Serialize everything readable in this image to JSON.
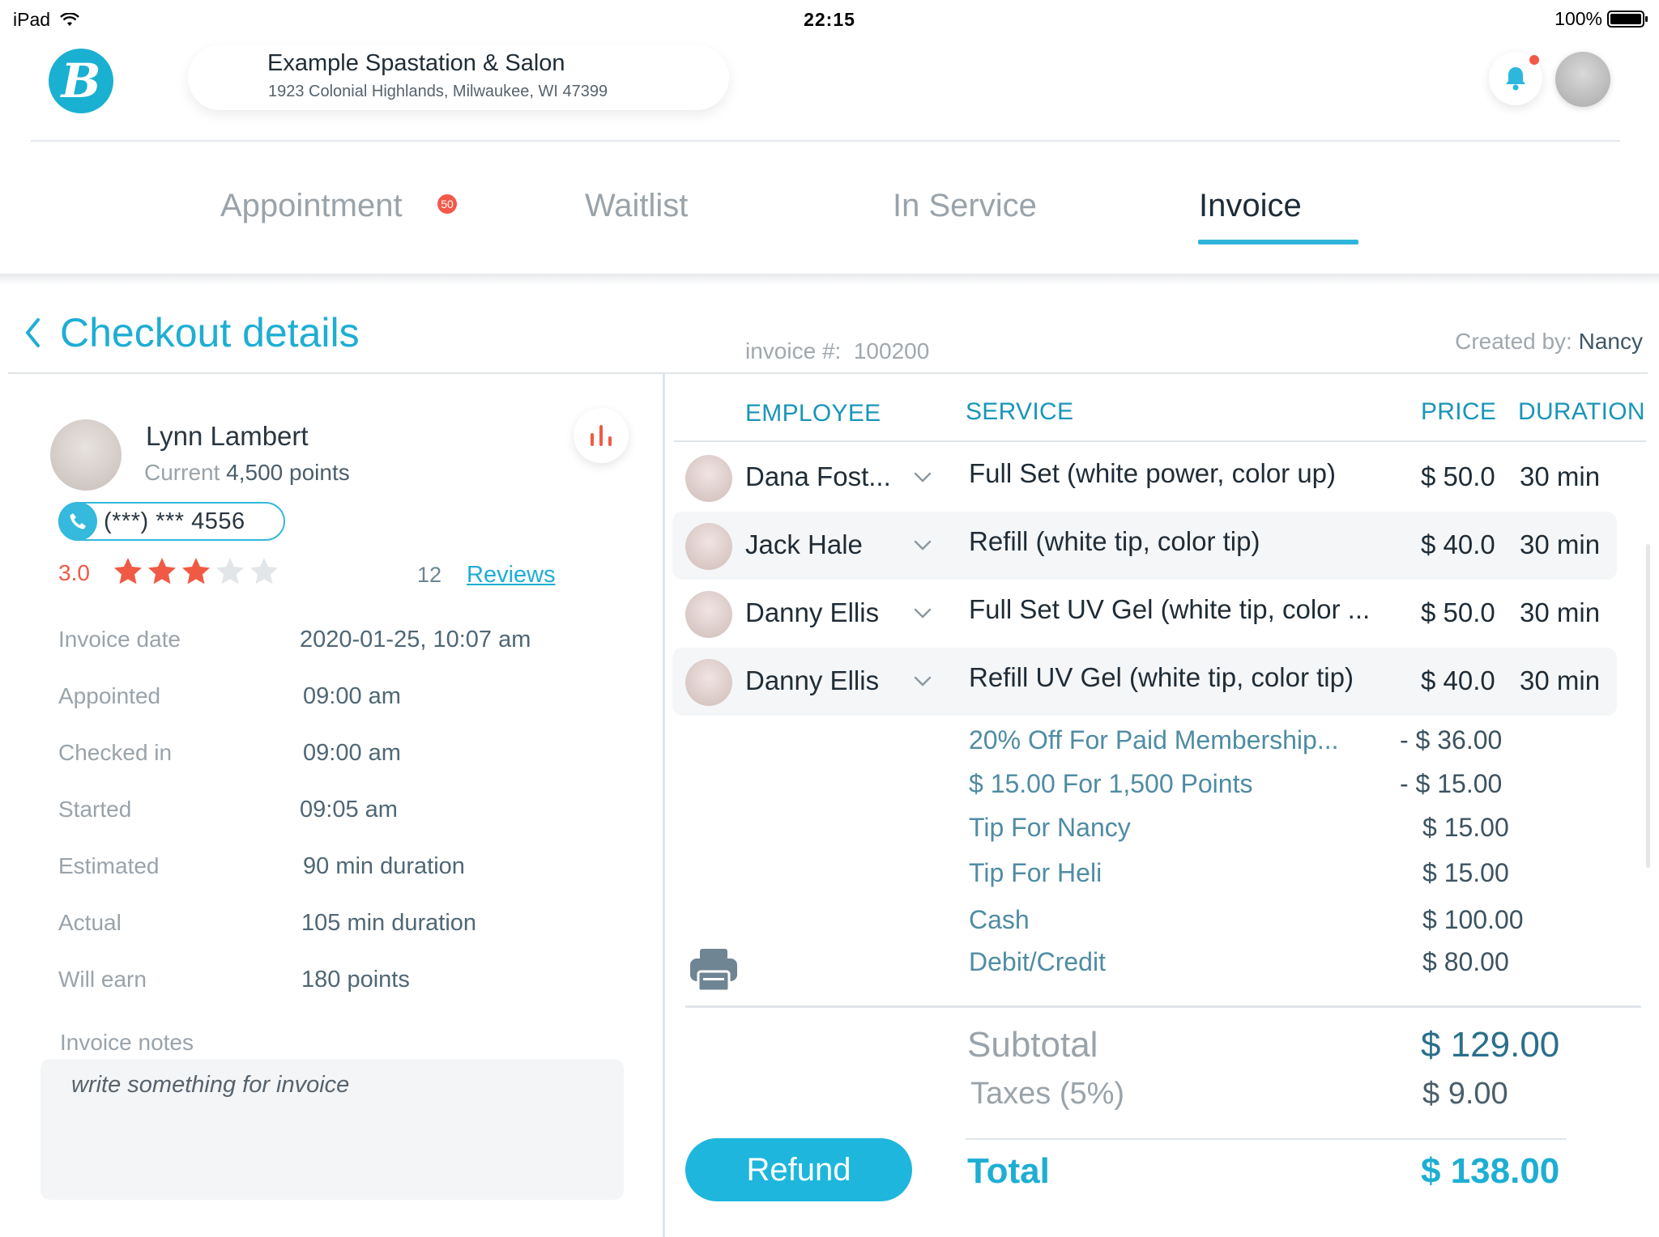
{
  "status_bar": {
    "device": "iPad",
    "time": "22:15",
    "battery": "100%"
  },
  "header": {
    "logo_letter": "B",
    "shop_name": "Example Spastation & Salon",
    "shop_address": "1923 Colonial Highlands, Milwaukee, WI 47399"
  },
  "tabs": [
    {
      "label": "Appointment",
      "badge": "50"
    },
    {
      "label": "Waitlist"
    },
    {
      "label": "In Service"
    },
    {
      "label": "Invoice",
      "active": true
    }
  ],
  "checkout": {
    "title": "Checkout details",
    "invoice_label": "invoice #:",
    "invoice_number": "100200",
    "created_label": "Created by:",
    "created_by": "Nancy"
  },
  "customer": {
    "name": "Lynn Lambert",
    "points_prefix": "Current",
    "points": "4,500 points",
    "phone": "(***) *** 4556",
    "rating": "3.0",
    "stars_filled": 3,
    "stars_total": 5,
    "review_count": "12",
    "reviews_link": "Reviews"
  },
  "details": [
    {
      "label": "Invoice date",
      "value": "2020-01-25, 10:07 am"
    },
    {
      "label": "Appointed",
      "value": "09:00 am"
    },
    {
      "label": "Checked in",
      "value": "09:00 am"
    },
    {
      "label": "Started",
      "value": "09:05 am"
    },
    {
      "label": "Estimated",
      "value": "90 min duration"
    },
    {
      "label": "Actual",
      "value": "105 min duration"
    },
    {
      "label": "Will earn",
      "value": "180 points"
    }
  ],
  "notes": {
    "label": "Invoice notes",
    "placeholder": "write something for invoice"
  },
  "table": {
    "headers": {
      "employee": "EMPLOYEE",
      "service": "SERVICE",
      "price": "PRICE",
      "duration": "DURATION"
    },
    "rows": [
      {
        "employee": "Dana Fost...",
        "service": "Full Set (white power, color up)",
        "price": "$ 50.0",
        "duration": "30 min"
      },
      {
        "employee": "Jack Hale",
        "service": "Refill (white tip, color tip)",
        "price": "$ 40.0",
        "duration": "30 min"
      },
      {
        "employee": "Danny Ellis",
        "service": "Full Set UV Gel (white tip, color ...",
        "price": "$ 50.0",
        "duration": "30 min"
      },
      {
        "employee": "Danny Ellis",
        "service": "Refill UV Gel (white tip, color tip)",
        "price": "$ 40.0",
        "duration": "30 min"
      }
    ]
  },
  "adjustments": [
    {
      "label": "20% Off For Paid Membership...",
      "value": "- $ 36.00"
    },
    {
      "label": "$ 15.00 For 1,500 Points",
      "value": "- $ 15.00"
    },
    {
      "label": "Tip For Nancy",
      "value": "$ 15.00"
    },
    {
      "label": "Tip For Heli",
      "value": "$ 15.00"
    },
    {
      "label": "Cash",
      "value": "$ 100.00"
    },
    {
      "label": "Debit/Credit",
      "value": "$ 80.00"
    }
  ],
  "summary": {
    "subtotal_label": "Subtotal",
    "subtotal": "$ 129.00",
    "taxes_label": "Taxes (5%)",
    "taxes": "$ 9.00",
    "total_label": "Total",
    "total": "$ 138.00"
  },
  "actions": {
    "refund_label": "Refund"
  },
  "colors": {
    "accent": "#1eaed3",
    "badge": "#f2594b",
    "star": "#f05a45",
    "star_empty": "#e3e6e9"
  },
  "icons": [
    "wifi-icon",
    "battery-icon",
    "bell-icon",
    "back-chevron-icon",
    "bar-chart-icon",
    "phone-icon",
    "star-icon",
    "chevron-down-icon",
    "printer-icon"
  ]
}
